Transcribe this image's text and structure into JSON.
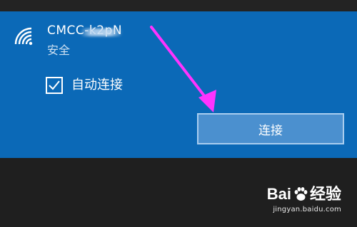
{
  "network": {
    "name": "CMCC-k2pN",
    "security": "安全"
  },
  "options": {
    "auto_connect_label": "自动连接",
    "auto_connect_checked": true
  },
  "actions": {
    "connect_label": "连接"
  },
  "watermark": {
    "brand_left": "Bai",
    "brand_right": "经验",
    "url": "jingyan.baidu.com"
  },
  "colors": {
    "panel": "#0b69b7",
    "button": "#4b90cf",
    "button_border": "#a9cdef",
    "arrow": "#ff33ff",
    "background": "#1f1f1f"
  },
  "icons": {
    "wifi": "wifi-signal-icon",
    "checkbox": "checkmark-icon",
    "annotation": "arrow-annotation",
    "paw": "baidu-paw-icon"
  }
}
